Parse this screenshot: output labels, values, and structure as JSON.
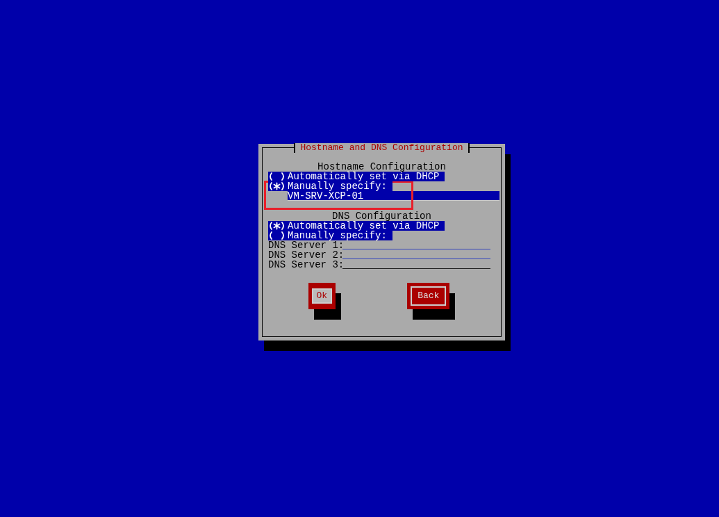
{
  "dialog": {
    "title": "Hostname and DNS Configuration"
  },
  "hostname": {
    "heading": "Hostname Configuration",
    "options": [
      {
        "label": "Automatically set via DHCP",
        "selected": false
      },
      {
        "label": "Manually specify:",
        "selected": true
      }
    ],
    "value": "VM-SRV-XCP-01"
  },
  "dns": {
    "heading": "DNS Configuration",
    "options": [
      {
        "label": "Automatically set via DHCP",
        "selected": true
      },
      {
        "label": "Manually specify:",
        "selected": false
      }
    ],
    "servers": [
      {
        "label": "DNS Server 1:"
      },
      {
        "label": "DNS Server 2:"
      },
      {
        "label": "DNS Server 3:"
      }
    ]
  },
  "buttons": [
    {
      "label": "Ok",
      "selected": true
    },
    {
      "label": "Back",
      "selected": false
    }
  ]
}
